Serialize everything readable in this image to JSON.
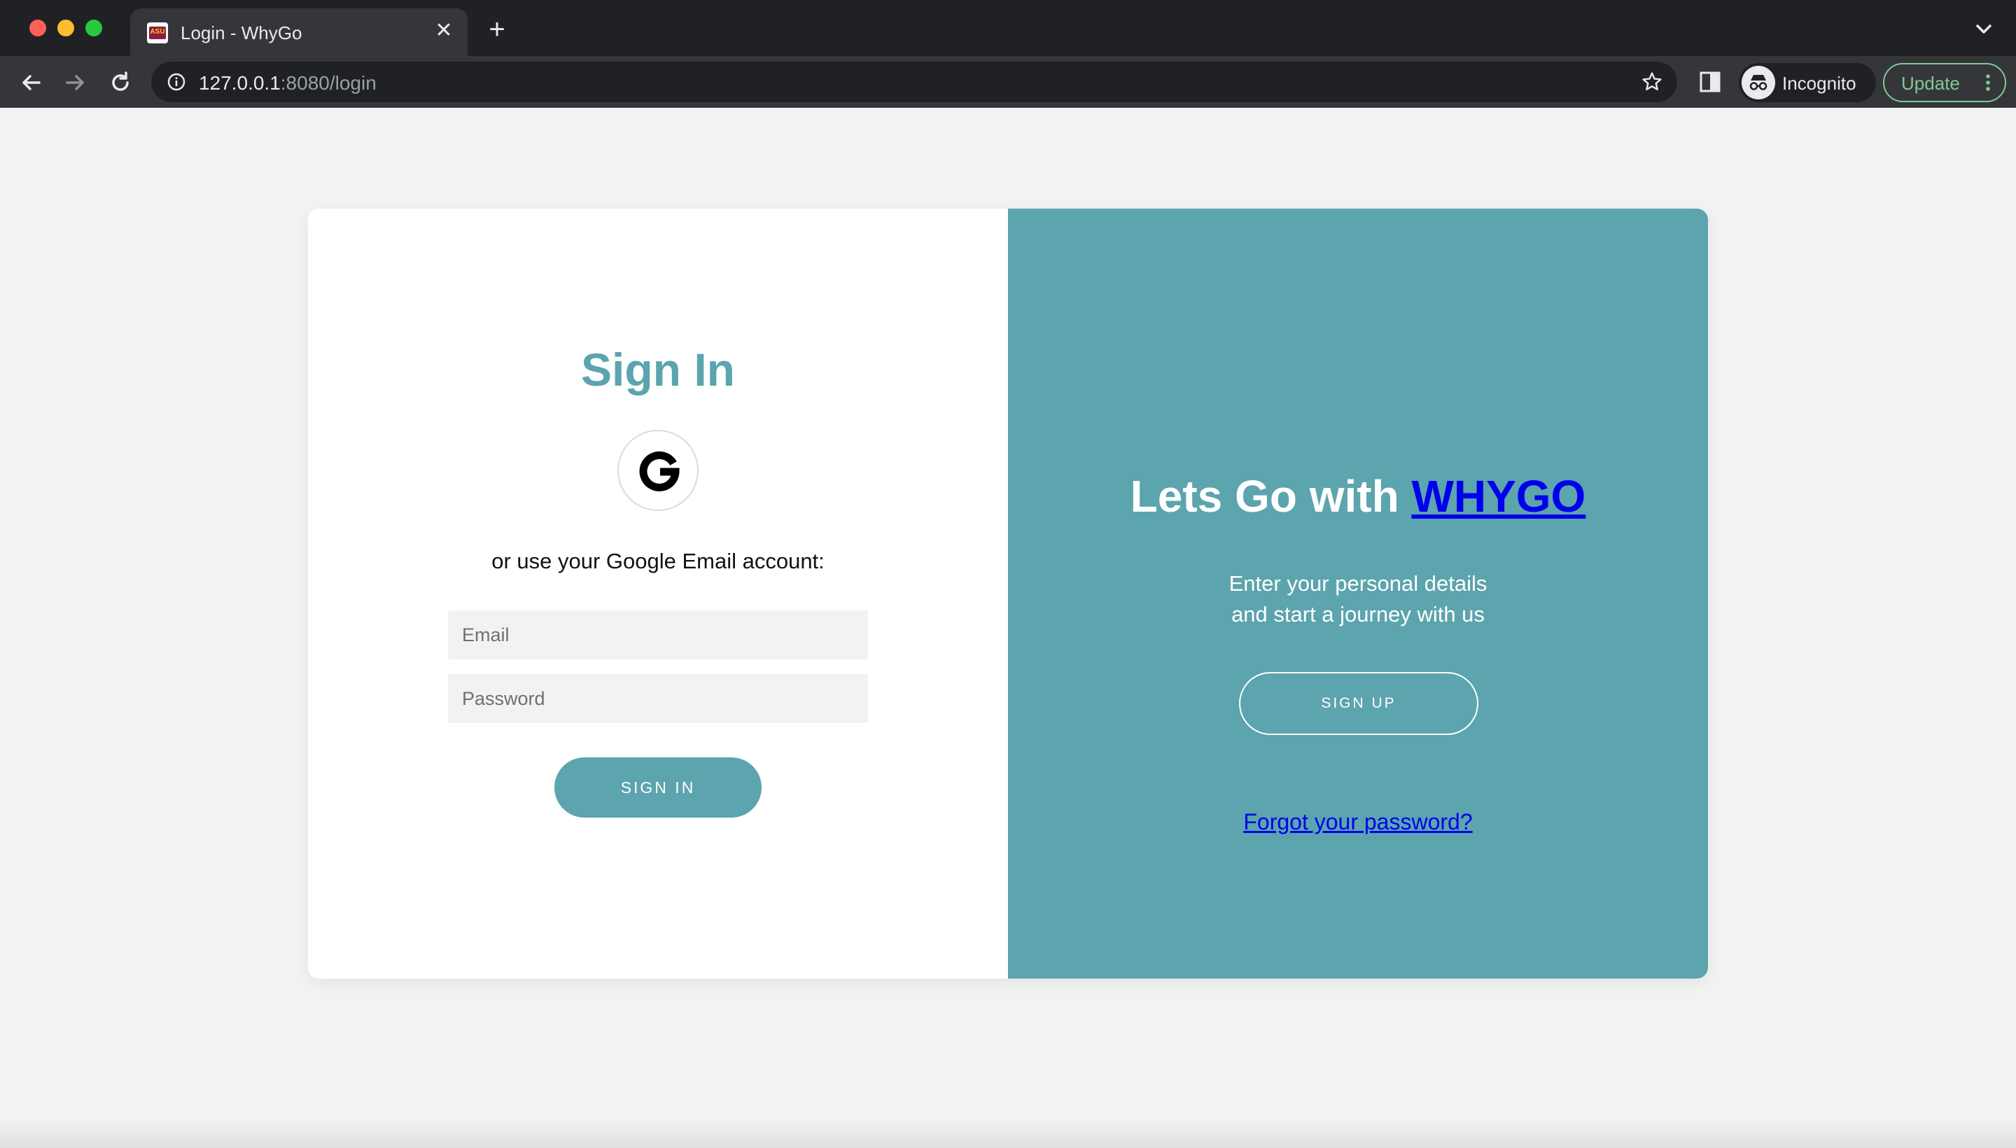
{
  "browser": {
    "tab_title": "Login - WhyGo",
    "favicon_text": "ASU",
    "close_glyph": "✕",
    "new_tab_glyph": "+",
    "url_host": "127.0.0.1",
    "url_rest": ":8080/login",
    "incognito_label": "Incognito",
    "update_label": "Update"
  },
  "signin": {
    "title": "Sign In",
    "alt_text": "or use your Google Email account:",
    "email_placeholder": "Email",
    "password_placeholder": "Password",
    "button_label": "SIGN IN"
  },
  "panel": {
    "heading_prefix": "Lets Go with ",
    "heading_link": "WHYGO",
    "desc_line1": "Enter your personal details",
    "desc_line2": "and start a journey with us",
    "signup_label": "SIGN UP",
    "forgot_label": "Forgot your password?"
  },
  "colors": {
    "accent": "#5ca4ae",
    "link": "#0000ee",
    "page_bg": "#f1f3f2"
  },
  "icons": {
    "google": "google-g-icon",
    "back": "arrow-left-icon",
    "forward": "arrow-right-icon",
    "reload": "reload-icon",
    "info": "info-icon",
    "bookmark": "star-icon",
    "side_panel": "side-panel-icon",
    "incognito": "incognito-icon",
    "menu": "kebab-menu-icon",
    "tab_search": "chevron-down-icon"
  }
}
